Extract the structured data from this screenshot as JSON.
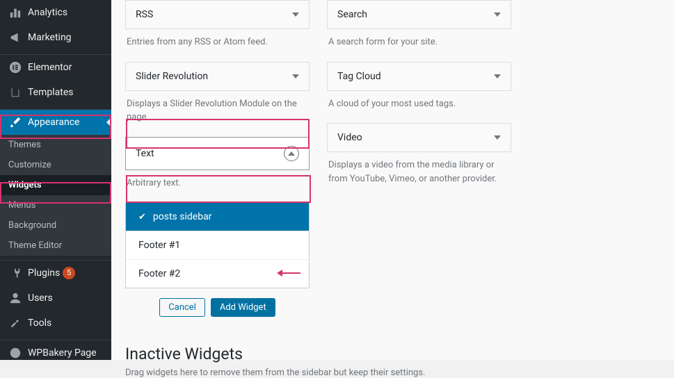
{
  "sidebar": {
    "items": [
      {
        "label": "Analytics"
      },
      {
        "label": "Marketing"
      },
      {
        "label": "Elementor"
      },
      {
        "label": "Templates"
      },
      {
        "label": "Appearance"
      },
      {
        "label": "Plugins",
        "badge": "5"
      },
      {
        "label": "Users"
      },
      {
        "label": "Tools"
      },
      {
        "label": "WPBakery Page"
      }
    ],
    "submenu": [
      {
        "label": "Themes"
      },
      {
        "label": "Customize"
      },
      {
        "label": "Widgets"
      },
      {
        "label": "Menus"
      },
      {
        "label": "Background"
      },
      {
        "label": "Theme Editor"
      }
    ]
  },
  "widgets": {
    "left": [
      {
        "title": "RSS",
        "desc": "Entries from any RSS or Atom feed."
      },
      {
        "title": "Slider Revolution",
        "desc": "Displays a Slider Revolution Module on the page"
      },
      {
        "title": "Text",
        "desc": "Arbitrary text.",
        "open": true
      }
    ],
    "right": [
      {
        "title": "Search",
        "desc": "A search form for your site."
      },
      {
        "title": "Tag Cloud",
        "desc": "A cloud of your most used tags."
      },
      {
        "title": "Video",
        "desc": "Displays a video from the media library or from YouTube, Vimeo, or another provider."
      }
    ]
  },
  "areas": [
    {
      "label": "posts sidebar",
      "selected": true
    },
    {
      "label": "Footer #1"
    },
    {
      "label": "Footer #2"
    }
  ],
  "buttons": {
    "cancel": "Cancel",
    "add": "Add Widget"
  },
  "inactive": {
    "title": "Inactive Widgets",
    "desc": "Drag widgets here to remove them from the sidebar but keep their settings."
  }
}
